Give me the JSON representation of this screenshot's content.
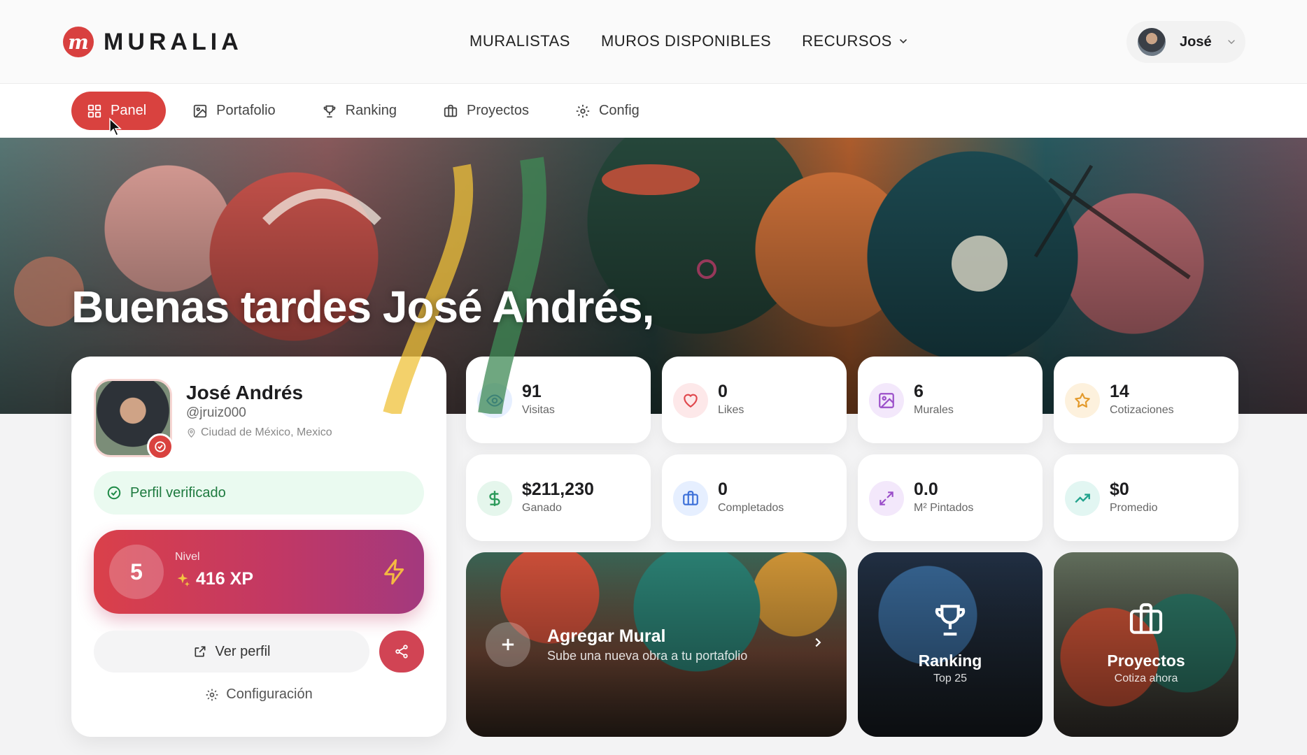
{
  "brand": {
    "logo_letter": "m",
    "name": "MURALIA",
    "accent": "#d9423f"
  },
  "mainnav": {
    "items": [
      "MURALISTAS",
      "MUROS DISPONIBLES",
      "RECURSOS"
    ]
  },
  "user": {
    "name": "José"
  },
  "subnav": {
    "tabs": [
      {
        "label": "Panel",
        "icon": "dashboard-icon",
        "active": true
      },
      {
        "label": "Portafolio",
        "icon": "image-icon"
      },
      {
        "label": "Ranking",
        "icon": "trophy-icon"
      },
      {
        "label": "Proyectos",
        "icon": "briefcase-icon"
      },
      {
        "label": "Config",
        "icon": "gear-icon"
      }
    ]
  },
  "hero": {
    "greeting": "Buenas tardes José Andrés,"
  },
  "profile": {
    "name": "José Andrés",
    "handle": "@jruiz000",
    "location": "Ciudad de México, Mexico",
    "verified_label": "Perfil verificado",
    "level_number": "5",
    "level_label": "Nivel",
    "xp": "416 XP",
    "view_profile_label": "Ver perfil",
    "settings_label": "Configuración"
  },
  "stats": [
    {
      "value": "91",
      "label": "Visitas",
      "icon": "eye-icon",
      "color": "#3b6fd8"
    },
    {
      "value": "0",
      "label": "Likes",
      "icon": "heart-icon",
      "color": "#e0474c"
    },
    {
      "value": "6",
      "label": "Murales",
      "icon": "image-icon",
      "color": "#9b4fc9"
    },
    {
      "value": "14",
      "label": "Cotizaciones",
      "icon": "star-icon",
      "color": "#e39a2c"
    },
    {
      "value": "$211,230",
      "label": "Ganado",
      "icon": "dollar-icon",
      "color": "#2c9a5a"
    },
    {
      "value": "0",
      "label": "Completados",
      "icon": "briefcase-icon",
      "color": "#3b6fd8"
    },
    {
      "value": "0.0",
      "label": "M² Pintados",
      "icon": "expand-icon",
      "color": "#9b4fc9"
    },
    {
      "value": "$0",
      "label": "Promedio",
      "icon": "trending-up-icon",
      "color": "#22a38d"
    }
  ],
  "tiles": {
    "agregar": {
      "title": "Agregar Mural",
      "subtitle": "Sube una nueva obra a tu portafolio"
    },
    "ranking": {
      "title": "Ranking",
      "subtitle": "Top 25"
    },
    "proyectos": {
      "title": "Proyectos",
      "subtitle": "Cotiza ahora"
    }
  }
}
